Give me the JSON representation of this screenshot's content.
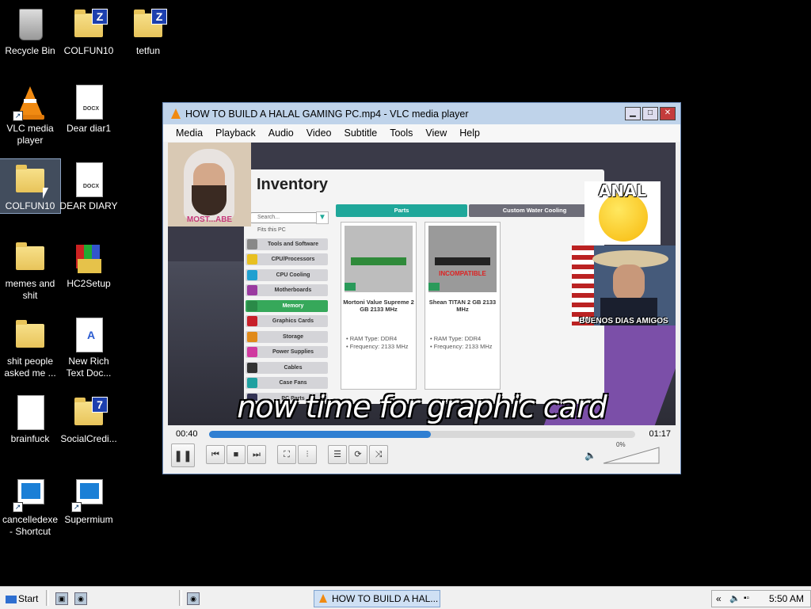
{
  "desktop": {
    "icons": [
      {
        "label": "Recycle Bin",
        "icon": "recycle-bin-icon"
      },
      {
        "label": "COLFUN10",
        "icon": "zip-folder-icon"
      },
      {
        "label": "tetfun",
        "icon": "zip-folder-icon"
      },
      {
        "label": "VLC media player",
        "icon": "vlc-icon"
      },
      {
        "label": "Dear diar1",
        "icon": "docx-icon"
      },
      {
        "label": "COLFUN10",
        "icon": "folder-icon"
      },
      {
        "label": "DEAR DIARY",
        "icon": "docx-icon"
      },
      {
        "label": "memes and shit",
        "icon": "folder-icon"
      },
      {
        "label": "HC2Setup",
        "icon": "winrar-installer-icon"
      },
      {
        "label": "shit people asked me ...",
        "icon": "folder-icon"
      },
      {
        "label": "New Rich Text Doc...",
        "icon": "rtf-icon"
      },
      {
        "label": "brainfuck",
        "icon": "text-file-icon"
      },
      {
        "label": "SocialCredi...",
        "icon": "zip-folder-icon"
      },
      {
        "label": "cancelledexe - Shortcut",
        "icon": "app-shortcut-icon"
      },
      {
        "label": "Supermium",
        "icon": "app-shortcut-icon"
      }
    ]
  },
  "vlc": {
    "title": "HOW TO BUILD A HALAL GAMING PC.mp4 - VLC media player",
    "menu": [
      "Media",
      "Playback",
      "Audio",
      "Video",
      "Subtitle",
      "Tools",
      "View",
      "Help"
    ],
    "video": {
      "inventory_title": "Inventory",
      "search_placeholder": "Search...",
      "fits_label": "Fits this PC",
      "tabs": [
        "Parts",
        "Custom Water Cooling"
      ],
      "categories": [
        "Tools and Software",
        "CPU/Processors",
        "CPU Cooling",
        "Motherboards",
        "Memory",
        "Graphics Cards",
        "Storage",
        "Power Supplies",
        "Cables",
        "Case Fans",
        "PC Parts"
      ],
      "active_category": "Memory",
      "cards": [
        {
          "name": "Mortoni Value Supreme 2 GB 2133 MHz",
          "spec1": "• RAM Type: DDR4",
          "spec2": "• Frequency: 2133 MHz",
          "incompatible": ""
        },
        {
          "name": "Shean TITAN 2 GB 2133 MHz",
          "spec1": "• RAM Type: DDR4",
          "spec2": "• Frequency: 2133 MHz",
          "incompatible": "INCOMPATIBLE"
        }
      ],
      "meme_left_caption": "MOST...ABE",
      "meme_top_right_caption": "ANAL",
      "meme_right_caption": "BUENOS DIAS AMIGOS",
      "subtitle": "now time for graphic card"
    },
    "time_elapsed": "00:40",
    "time_total": "01:17",
    "progress": 0.52,
    "volume": "0%"
  },
  "taskbar": {
    "start": "Start",
    "task_label": "HOW TO BUILD A HAL...",
    "clock": "5:50 AM",
    "tray_chevron": "«"
  },
  "colors": {
    "vlc_title_bg": "#bfd3ea",
    "progress_blue": "#2f7fd2",
    "inventory_tab_teal": "#1fa79a",
    "memory_active_green": "#36a85a"
  }
}
